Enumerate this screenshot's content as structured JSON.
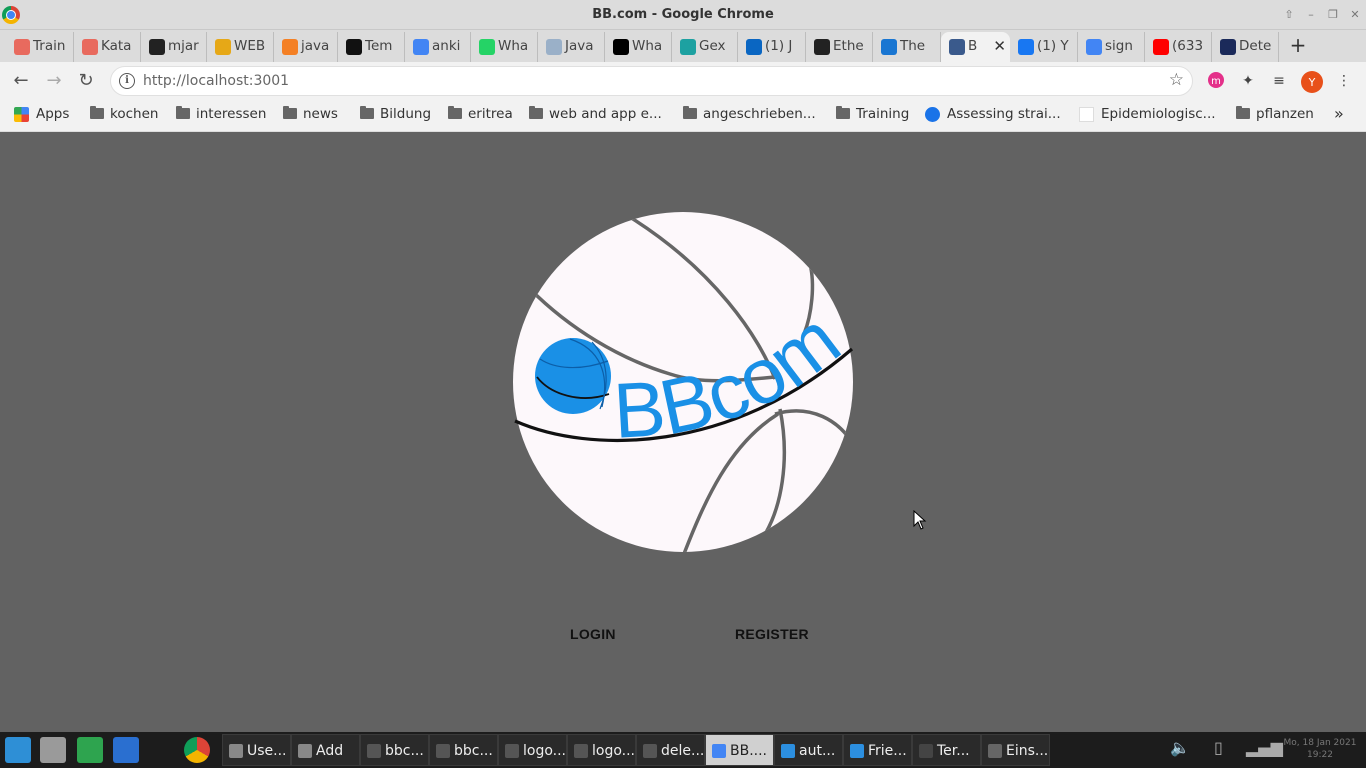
{
  "window": {
    "title": "BB.com - Google Chrome"
  },
  "tabs": [
    {
      "label": "Train",
      "fav": "#e86a5e"
    },
    {
      "label": "Kata",
      "fav": "#e86a5e"
    },
    {
      "label": "mjar",
      "fav": "#222222"
    },
    {
      "label": "WEB",
      "fav": "#e6a817"
    },
    {
      "label": "java",
      "fav": "#f48024"
    },
    {
      "label": "Tem",
      "fav": "#111111"
    },
    {
      "label": "anki",
      "fav": "#4285f4"
    },
    {
      "label": "Wha",
      "fav": "#25d366"
    },
    {
      "label": "Java",
      "fav": "#9ab0c8"
    },
    {
      "label": "Wha",
      "fav": "#000000"
    },
    {
      "label": "Gex",
      "fav": "#1da1a1"
    },
    {
      "label": "(1) J",
      "fav": "#0a66c2"
    },
    {
      "label": "Ethe",
      "fav": "#222222"
    },
    {
      "label": "The",
      "fav": "#1976d2"
    },
    {
      "label": "B",
      "fav": "#3a5a8c"
    },
    {
      "label": "(1) Y",
      "fav": "#1877f2"
    },
    {
      "label": "sign",
      "fav": "#4285f4"
    },
    {
      "label": "(633",
      "fav": "#ff0000"
    },
    {
      "label": "Dete",
      "fav": "#1b2a5a"
    }
  ],
  "toolbar": {
    "url": "http://localhost:3001",
    "profile_initial": "Y"
  },
  "bookmarks": [
    {
      "label": "Apps",
      "icon": "apps-grid-icon"
    },
    {
      "label": "kochen",
      "icon": "folder-icon"
    },
    {
      "label": "interessen",
      "icon": "folder-icon"
    },
    {
      "label": "news",
      "icon": "folder-icon"
    },
    {
      "label": "Bildung",
      "icon": "folder-icon"
    },
    {
      "label": "eritrea",
      "icon": "folder-icon"
    },
    {
      "label": "web and app e...",
      "icon": "folder-icon"
    },
    {
      "label": "angeschrieben...",
      "icon": "folder-icon"
    },
    {
      "label": "Training",
      "icon": "folder-icon"
    },
    {
      "label": "Assessing strai...",
      "icon": "site-icon"
    },
    {
      "label": "Epidemiologisc...",
      "icon": "blank-page-icon"
    },
    {
      "label": "pflanzen",
      "icon": "folder-icon"
    }
  ],
  "page": {
    "logo_text": "BBcom",
    "login_label": "LOGIN",
    "register_label": "REGISTER",
    "colors": {
      "background": "#626262",
      "logo_blue": "#1a90e6",
      "ball": "#fdf8fb",
      "seam": "#666666"
    }
  },
  "taskbar": {
    "tasks": [
      {
        "label": "Use...",
        "icon": "#888888"
      },
      {
        "label": "Add",
        "icon": "#888888"
      },
      {
        "label": "bbc...",
        "icon": "#555555"
      },
      {
        "label": "bbc...",
        "icon": "#555555"
      },
      {
        "label": "logo...",
        "icon": "#555555"
      },
      {
        "label": "logo...",
        "icon": "#555555"
      },
      {
        "label": "dele...",
        "icon": "#555555"
      },
      {
        "label": "BB....",
        "icon": "#4285f4"
      },
      {
        "label": "aut...",
        "icon": "#2c8fe0"
      },
      {
        "label": "Frie...",
        "icon": "#2c8fe0"
      },
      {
        "label": "Ter...",
        "icon": "#444444"
      },
      {
        "label": "Eins...",
        "icon": "#666666"
      }
    ],
    "clock_date": "Mo, 18 Jan 2021",
    "clock_time": "19:22"
  }
}
